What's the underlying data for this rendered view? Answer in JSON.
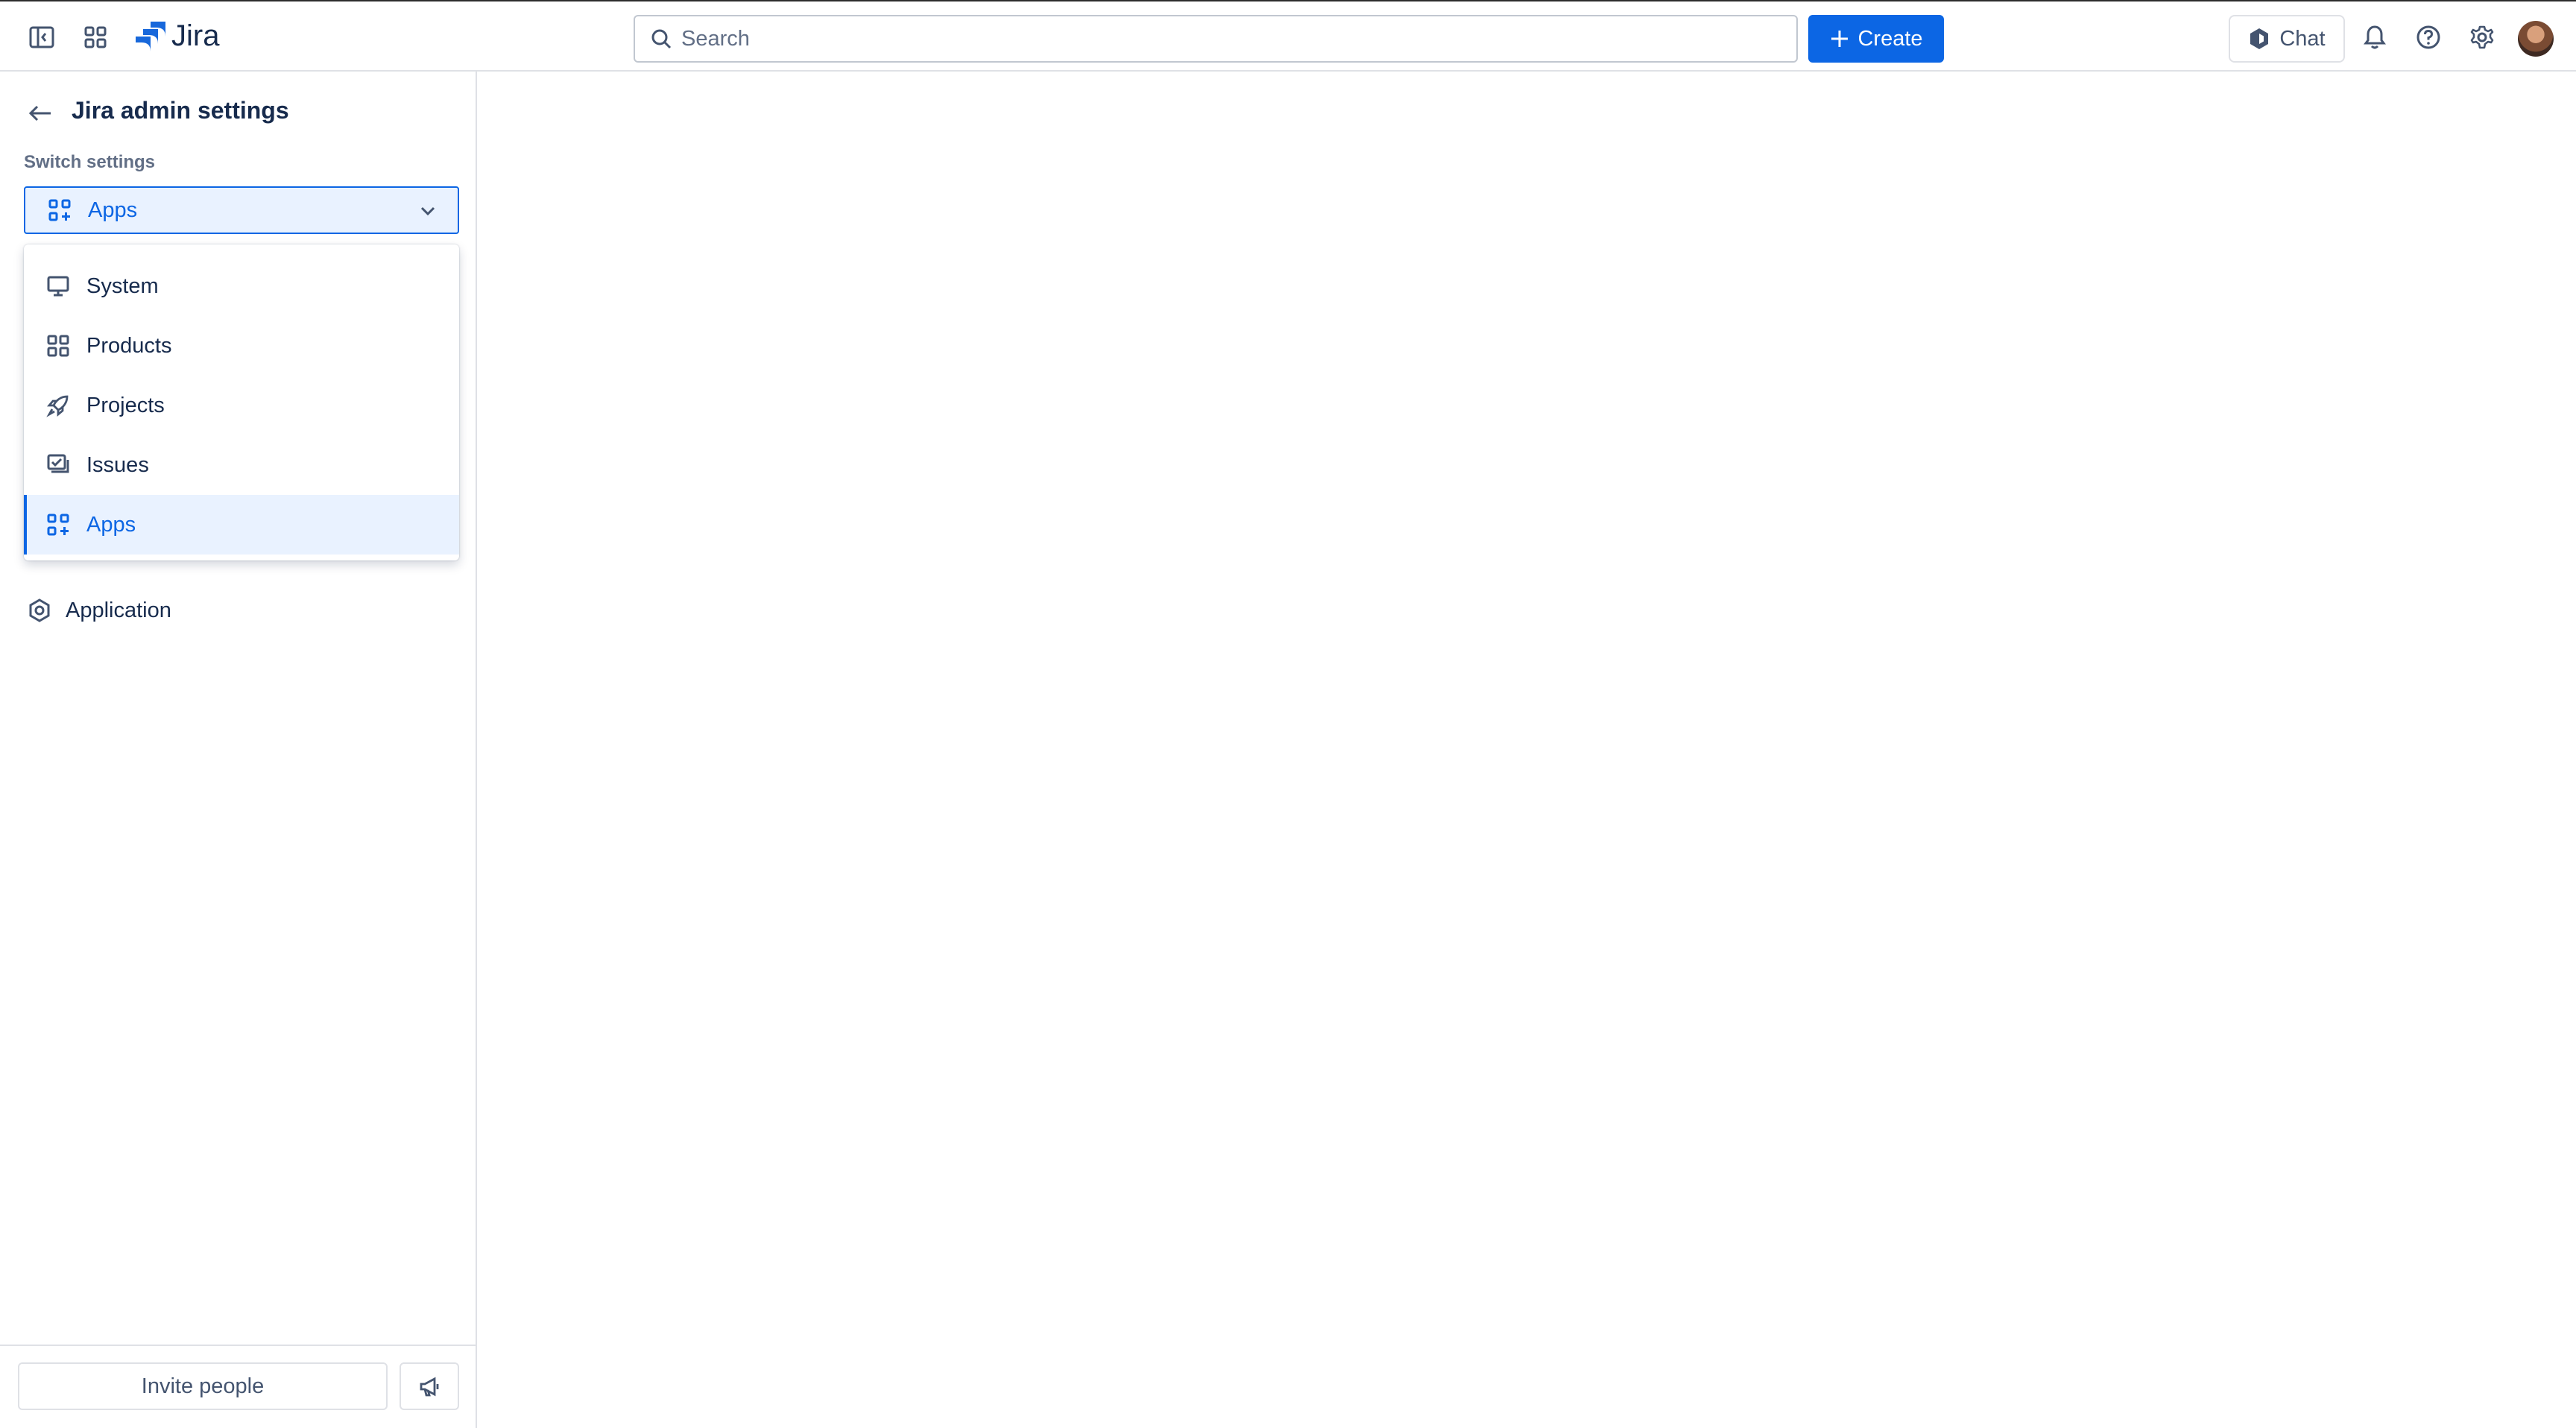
{
  "topbar": {
    "logo_text": "Jira",
    "search_placeholder": "Search",
    "create_label": "Create",
    "chat_label": "Chat",
    "accent_color": "#0c66e4"
  },
  "sidebar": {
    "title": "Jira admin settings",
    "switch_label": "Switch settings",
    "selected_value": "Apps",
    "menu": [
      {
        "label": "System",
        "icon": "monitor-icon"
      },
      {
        "label": "Products",
        "icon": "grid-icon"
      },
      {
        "label": "Projects",
        "icon": "rocket-icon"
      },
      {
        "label": "Issues",
        "icon": "issues-icon"
      },
      {
        "label": "Apps",
        "icon": "apps-icon",
        "selected": true
      }
    ],
    "application_label": "Application",
    "invite_label": "Invite people"
  }
}
